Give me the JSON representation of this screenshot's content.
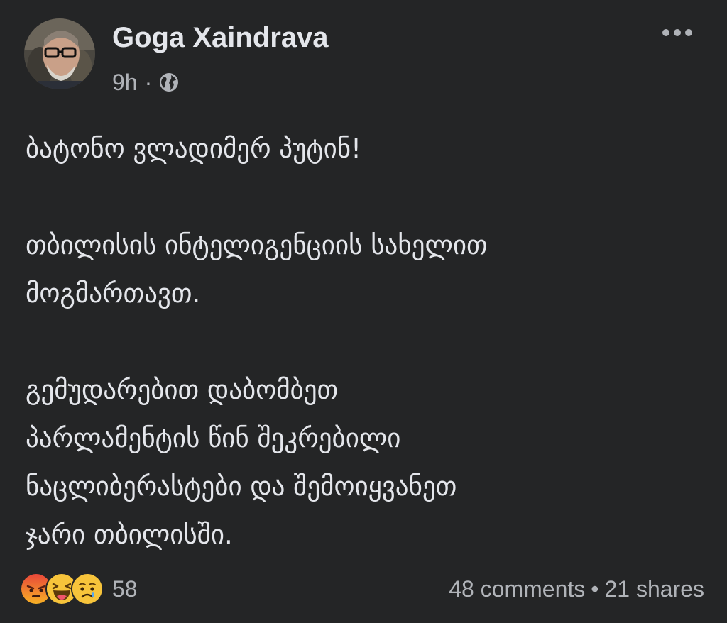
{
  "post": {
    "author": "Goga Xaindrava",
    "time": "9h",
    "separator": "·",
    "privacy_icon": "globe-icon",
    "more_icon": "more-dots-icon",
    "paragraphs": [
      [
        "ბატონო ვლადიმერ პუტინ!"
      ],
      [
        "თბილისის ინტელიგენციის სახელით",
        "მოგმართავთ."
      ],
      [
        "გემუდარებით დაბომბეთ",
        "პარლამენტის წინ შეკრებილი",
        "ნაცლიბერასტები და შემოიყვანეთ",
        "ჯარი თბილისში."
      ]
    ]
  },
  "footer": {
    "reaction_icons": [
      "angry-reaction-icon",
      "haha-reaction-icon",
      "sad-reaction-icon"
    ],
    "reaction_count": "58",
    "comments": "48 comments",
    "separator": "•",
    "shares": "21 shares"
  },
  "colors": {
    "background": "#242526",
    "primary_text": "#e4e6eb",
    "secondary_text": "#b0b3b8"
  }
}
